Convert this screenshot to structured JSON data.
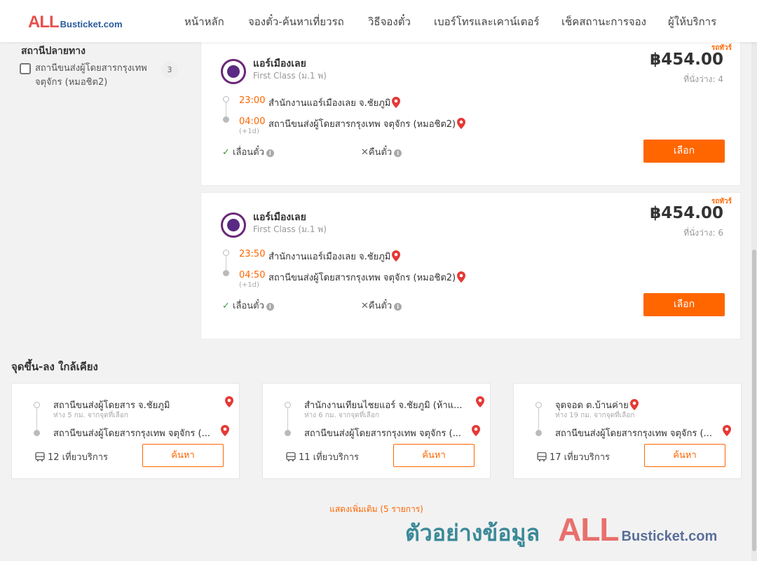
{
  "header": {
    "logo_all": "ALL",
    "logo_rest": "Busticket.com",
    "nav": [
      "หน้าหลัก",
      "จองตั๋ว-ค้นหาเที่ยวรถ",
      "วิธีจองตั๋ว",
      "เบอร์โทรและเคาน์เตอร์",
      "เช็คสถานะการจอง",
      "ผู้ให้บริการ"
    ]
  },
  "filter": {
    "title": "สถานีปลายทาง",
    "item_label": "สถานีขนส่งผู้โดยสารกรุงเทพ จตุจักร (หมอชิต2)",
    "item_count": "3"
  },
  "trips": [
    {
      "badge": "รถทัวร์",
      "operator": "แอร์เมืองเลย",
      "class": "First Class (ม.1 พ)",
      "price": "฿454.00",
      "seats": "ที่นั่งว่าง: 4",
      "dep_time": "23:00",
      "dep_place": "สำนักงานแอร์เมืองเลย จ.ชัยภูมิ",
      "arr_time": "04:00",
      "arr_place": "สถานีขนส่งผู้โดยสารกรุงเทพ จตุจักร (หมอชิต2)",
      "plus_day": "(+1d)",
      "change": "เลื่อนตั๋ว",
      "refund": "คืนตั๋ว",
      "select": "เลือก"
    },
    {
      "badge": "รถทัวร์",
      "operator": "แอร์เมืองเลย",
      "class": "First Class (ม.1 พ)",
      "price": "฿454.00",
      "seats": "ที่นั่งว่าง: 6",
      "dep_time": "23:50",
      "dep_place": "สำนักงานแอร์เมืองเลย จ.ชัยภูมิ",
      "arr_time": "04:50",
      "arr_place": "สถานีขนส่งผู้โดยสารกรุงเทพ จตุจักร (หมอชิต2)",
      "plus_day": "(+1d)",
      "change": "เลื่อนตั๋ว",
      "refund": "คืนตั๋ว",
      "select": "เลือก"
    }
  ],
  "nearby": {
    "title": "จุดขึ้น-ลง ใกล้เคียง",
    "cards": [
      {
        "from": "สถานีขนส่งผู้โดยสาร จ.ชัยภูมิ",
        "distance": "ห่าง 5 กม. จากจุดที่เลือก",
        "to": "สถานีขนส่งผู้โดยสารกรุงเทพ จตุจักร (...",
        "services": "12 เที่ยวบริการ",
        "search": "ค้นหา"
      },
      {
        "from": "สำนักงานเทียนไชยแอร์ จ.ชัยภูมิ (ห้าแ...",
        "distance": "ห่าง 6 กม. จากจุดที่เลือก",
        "to": "สถานีขนส่งผู้โดยสารกรุงเทพ จตุจักร (...",
        "services": "11 เที่ยวบริการ",
        "search": "ค้นหา"
      },
      {
        "from": "จุดจอด ต.บ้านค่าย",
        "distance": "ห่าง 19 กม. จากจุดที่เลือก",
        "to": "สถานีขนส่งผู้โดยสารกรุงเทพ จตุจักร (...",
        "services": "17 เที่ยวบริการ",
        "search": "ค้นหา"
      }
    ],
    "show_more": "แสดงเพิ่มเติม (5 รายการ)"
  },
  "watermark": {
    "text": "ตัวอย่างข้อมูล",
    "all": "ALL",
    "rest": "Busticket.com"
  },
  "colors": {
    "accent": "#ff6600",
    "logo_red": "#e8504e",
    "logo_blue": "#2a5b9e",
    "pin": "#e53935"
  },
  "icons": [
    "map-pin-icon",
    "check-icon",
    "cross-icon",
    "info-icon",
    "bus-icon"
  ]
}
